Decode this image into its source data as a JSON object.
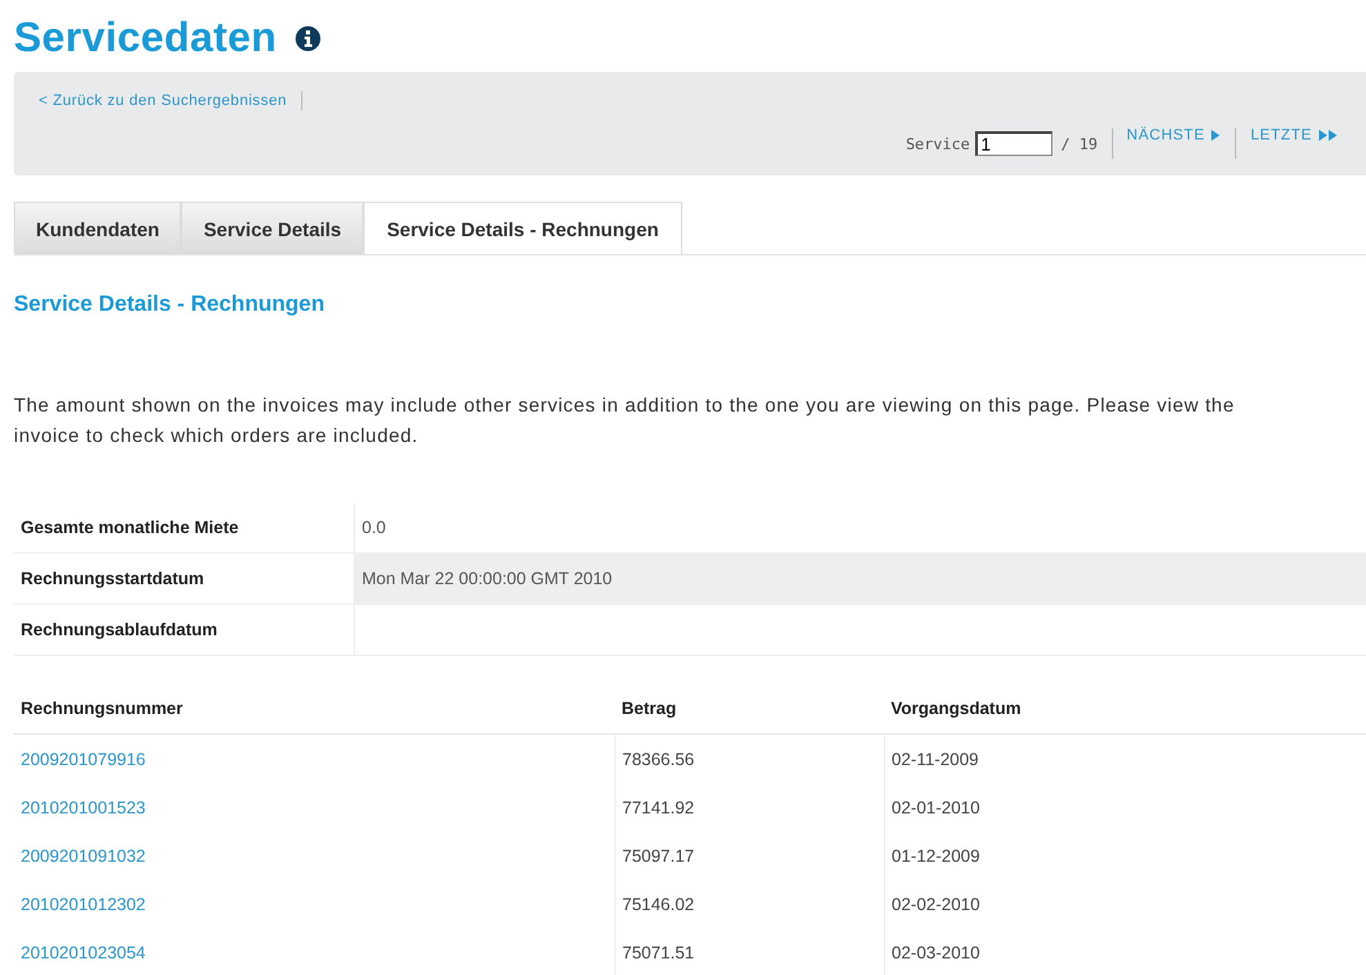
{
  "page": {
    "title": "Servicedaten"
  },
  "nav": {
    "back_link": "< Zurück zu den Suchergebnissen",
    "service_label": "Service",
    "service_value": "1",
    "service_total": "/ 19",
    "next": "NÄCHSTE",
    "last": "LETZTE"
  },
  "tabs": [
    {
      "label": "Kundendaten",
      "selected": false
    },
    {
      "label": "Service Details",
      "selected": false
    },
    {
      "label": "Service Details - Rechnungen",
      "selected": true
    }
  ],
  "section_title": "Service Details - Rechnungen",
  "notice": "The amount shown on the invoices may include other services in addition to the one you are viewing on this page. Please view the invoice to check which orders are included.",
  "summary": [
    {
      "label": "Gesamte monatliche Miete",
      "value": "0.0"
    },
    {
      "label": "Rechnungsstartdatum",
      "value": "Mon Mar 22 00:00:00 GMT 2010"
    },
    {
      "label": "Rechnungsablaufdatum"
    }
  ],
  "invoices": {
    "columns": [
      "Rechnungsnummer",
      "Betrag",
      "Vorgangsdatum"
    ],
    "rows": [
      [
        "2009201079916",
        "78366.56",
        "02-11-2009"
      ],
      [
        "2010201001523",
        "77141.92",
        "02-01-2010"
      ],
      [
        "2009201091032",
        "75097.17",
        "01-12-2009"
      ],
      [
        "2010201012302",
        "75146.02",
        "02-02-2010"
      ],
      [
        "2010201023054",
        "75071.51",
        "02-03-2010"
      ]
    ]
  }
}
